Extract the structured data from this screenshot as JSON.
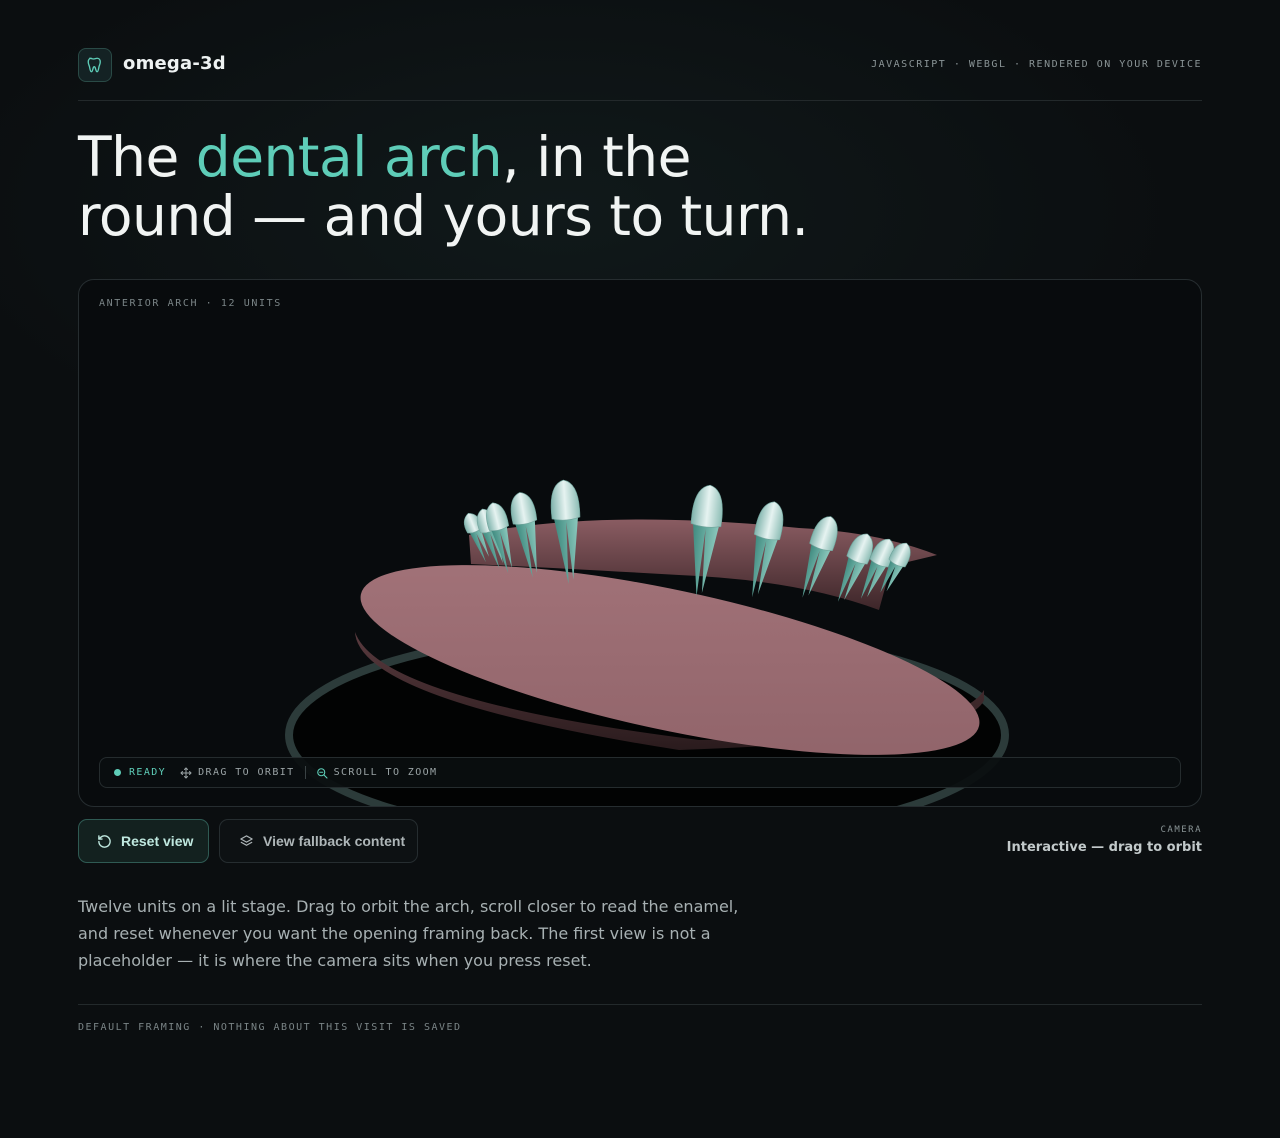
{
  "header": {
    "brand": "omega-3d",
    "tagline": "JAVASCRIPT · WEBGL · RENDERED ON YOUR DEVICE",
    "logo_icon": "tooth-icon"
  },
  "hero": {
    "line_prefix": "The ",
    "accent": "dental arch",
    "line_suffix": ", in the round — and yours to turn."
  },
  "viewer": {
    "label": "ANTERIOR ARCH · 12 UNITS",
    "status": {
      "ready": "READY",
      "orbit": "DRAG TO ORBIT",
      "zoom": "SCROLL TO ZOOM"
    }
  },
  "actions": {
    "reset_label": "Reset view",
    "fallback_label": "View fallback content"
  },
  "camera": {
    "label": "CAMERA",
    "value": "Interactive — drag to orbit"
  },
  "description": "Twelve units on a lit stage. Drag to orbit the arch, scroll closer to read the enamel, and reset whenever you want the opening framing back. The first view is not a placeholder — it is where the camera sits when you press reset.",
  "footer": "DEFAULT FRAMING · NOTHING ABOUT THIS VISIT IS SAVED",
  "colors": {
    "accent": "#5ecdb8",
    "background": "#0b0e10",
    "gum": "#9a6a70",
    "enamel": "#cfe6e2"
  }
}
